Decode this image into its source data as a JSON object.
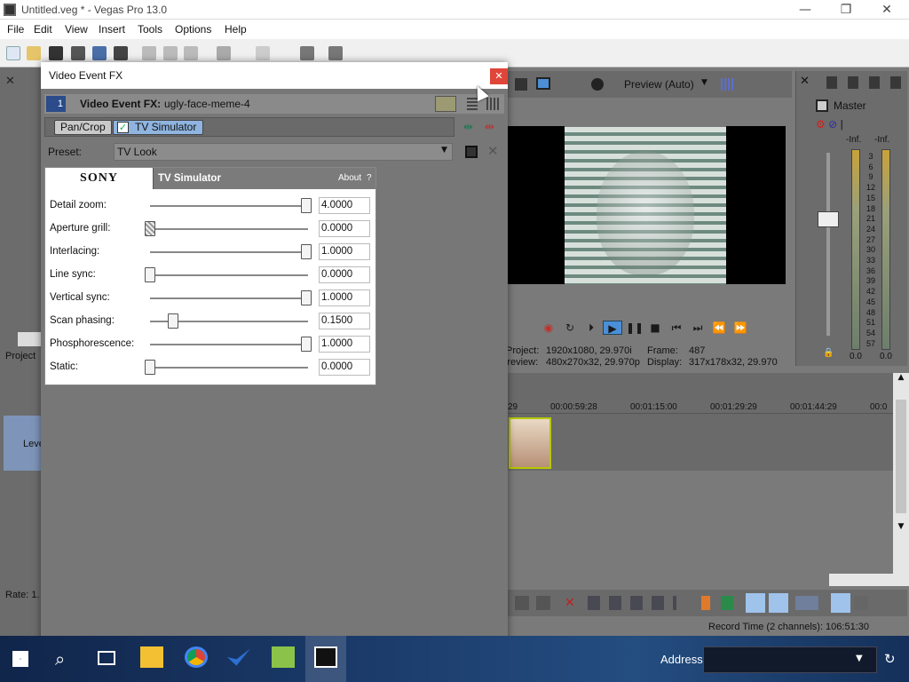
{
  "window": {
    "title": "Untitled.veg * - Vegas Pro 13.0",
    "minimize": "—",
    "restore": "❐",
    "close": "✕"
  },
  "menu": [
    "File",
    "Edit",
    "View",
    "Insert",
    "Tools",
    "Options",
    "Help"
  ],
  "preview": {
    "mode": "Preview (Auto)",
    "project_label": "Project:",
    "project_value": "1920x1080, 29.970i",
    "frame_label": "Frame:",
    "frame_value": "487",
    "preview_label": "Preview:",
    "preview_value": "480x270x32, 29.970p",
    "display_label": "Display:",
    "display_value": "317x178x32, 29.970"
  },
  "master": {
    "label": "Master",
    "meter_left_top": "-Inf.",
    "meter_right_top": "-Inf.",
    "scale": [
      "3",
      "6",
      "9",
      "12",
      "15",
      "18",
      "21",
      "24",
      "27",
      "30",
      "33",
      "36",
      "39",
      "42",
      "45",
      "48",
      "51",
      "54",
      "57"
    ],
    "left_bottom": "0.0",
    "right_bottom": "0.0"
  },
  "timeline": {
    "ruler": [
      "29",
      "00:00:59:28",
      "00:01:15:00",
      "00:01:29:29",
      "00:01:44:29",
      "00:0"
    ],
    "record_time": "Record Time (2 channels): 106:51:30"
  },
  "left_panel": {
    "project_tab": "Project",
    "track_label": "Leve",
    "rate_label": "Rate: 1."
  },
  "fx": {
    "window_title": "Video Event FX",
    "header_label": "Video Event FX:",
    "event_name": "ugly-face-meme-4",
    "chain": [
      "Pan/Crop",
      "TV Simulator"
    ],
    "preset_label": "Preset:",
    "preset_value": "TV Look",
    "plugin_brand": "SONY",
    "plugin_name": "TV Simulator",
    "about": "About",
    "about_q": "?",
    "params": [
      {
        "label": "Detail zoom:",
        "value": "4.0000",
        "level": 1.0
      },
      {
        "label": "Aperture grill:",
        "value": "0.0000",
        "level": 0.0
      },
      {
        "label": "Interlacing:",
        "value": "1.0000",
        "level": 1.0
      },
      {
        "label": "Line sync:",
        "value": "0.0000",
        "level": 0.0
      },
      {
        "label": "Vertical sync:",
        "value": "1.0000",
        "level": 1.0
      },
      {
        "label": "Scan phasing:",
        "value": "0.1500",
        "level": 0.15
      },
      {
        "label": "Phosphorescence:",
        "value": "1.0000",
        "level": 1.0
      },
      {
        "label": "Static:",
        "value": "0.0000",
        "level": 0.0
      }
    ]
  },
  "taskbar": {
    "address_label": "Address"
  }
}
